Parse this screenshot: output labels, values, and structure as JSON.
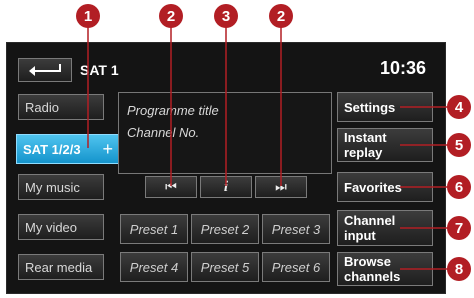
{
  "header": {
    "back_icon": "back-arrow-icon",
    "title": "SAT 1",
    "time": "10:36"
  },
  "left_menu": [
    {
      "label": "Radio"
    },
    {
      "label": "SAT 1/2/3",
      "active": true,
      "extra": "+"
    },
    {
      "label": "My music"
    },
    {
      "label": "My video"
    },
    {
      "label": "Rear media"
    }
  ],
  "info": {
    "line1": "Programme title",
    "line2": "Channel No."
  },
  "controls": {
    "prev_icon": "skip-previous-icon",
    "prev_glyph": "⏮",
    "info_icon": "info-icon",
    "info_glyph": "i",
    "next_icon": "skip-next-icon",
    "next_glyph": "⏭"
  },
  "presets": [
    "Preset 1",
    "Preset 2",
    "Preset 3",
    "Preset 4",
    "Preset 5",
    "Preset 6"
  ],
  "right_menu": [
    {
      "label": "Settings"
    },
    {
      "label": "Instant\nreplay"
    },
    {
      "label": "Favorites"
    },
    {
      "label": "Channel\ninput"
    },
    {
      "label": "Browse\nchannels"
    }
  ],
  "callouts": [
    "1",
    "2",
    "3",
    "2",
    "4",
    "5",
    "6",
    "7",
    "8"
  ],
  "colors": {
    "accent": "#29aee0",
    "callout": "#b21e24",
    "screen_bg": "#141414"
  }
}
